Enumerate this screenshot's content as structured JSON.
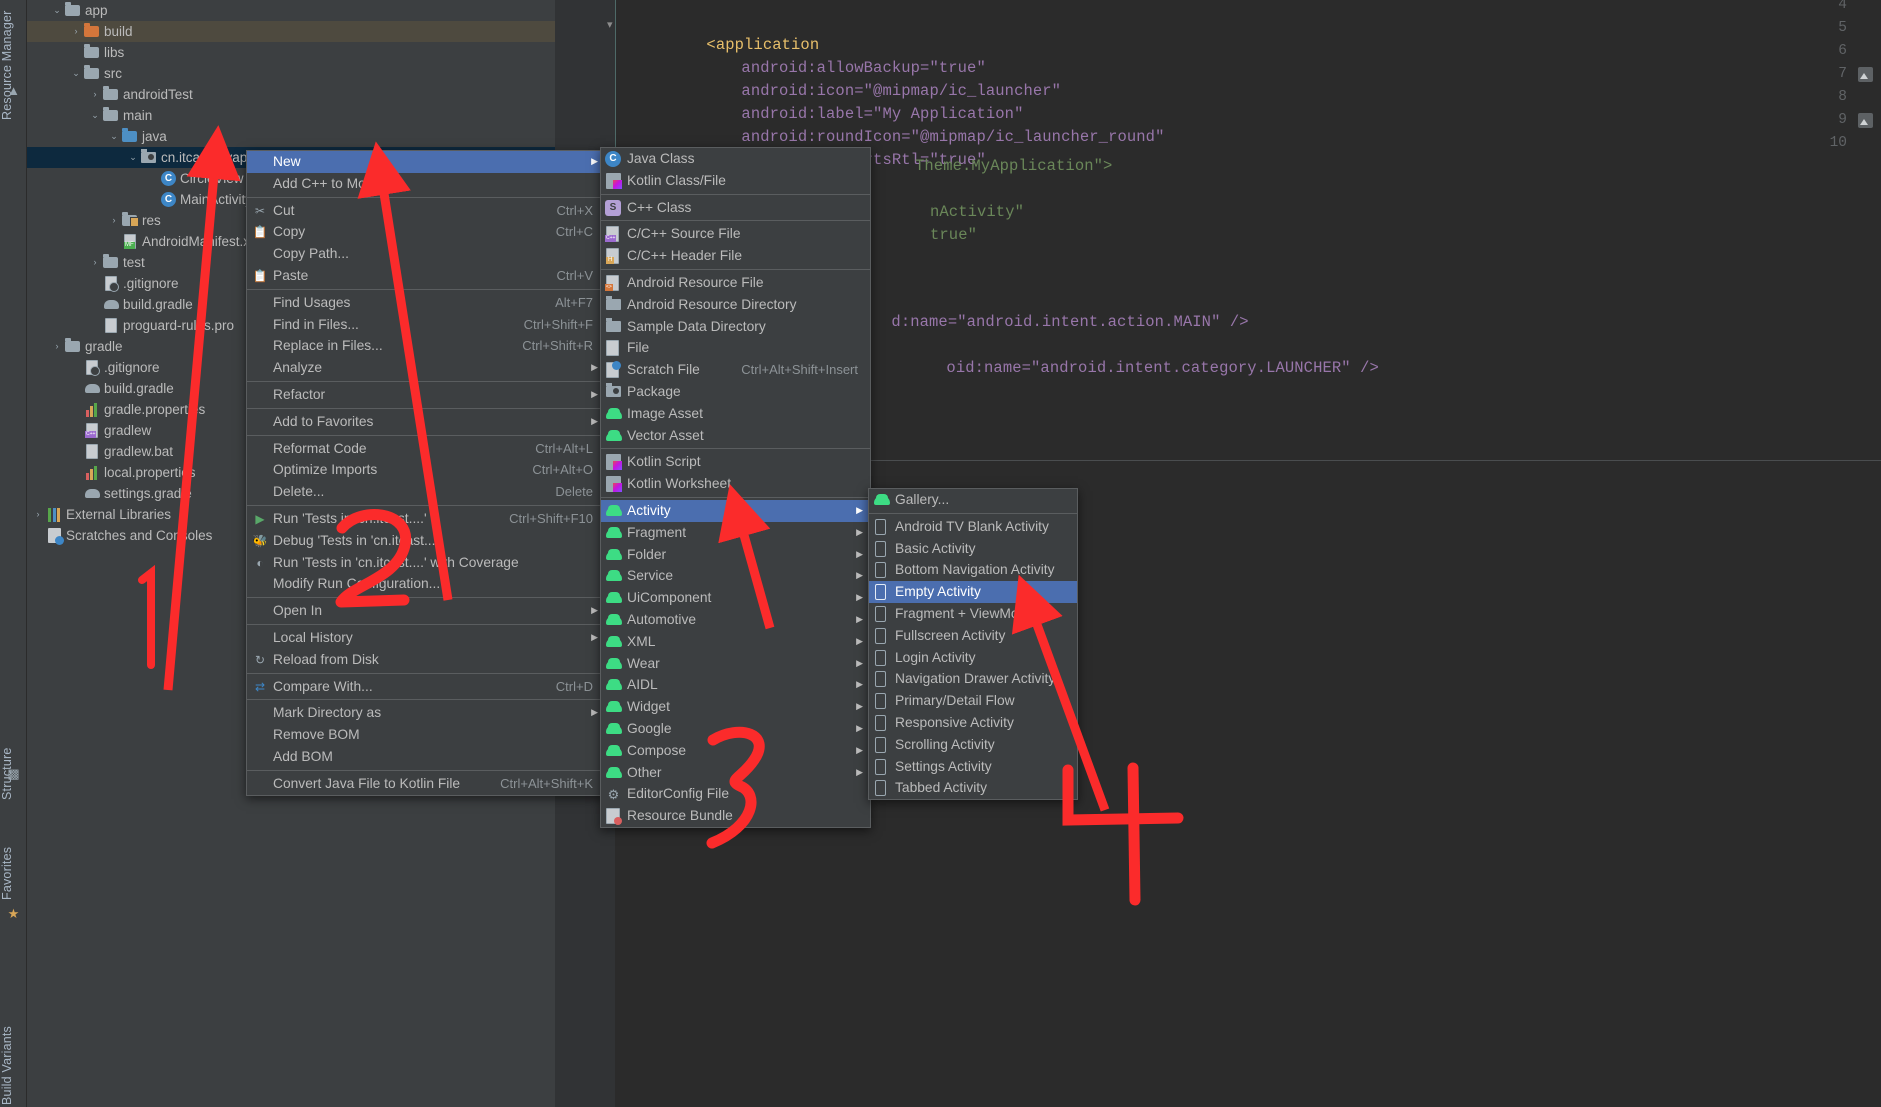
{
  "app": {
    "title": "Android Studio Project Tool Window with New > Activity > Empty Activity context menu"
  },
  "left_strip": {
    "tabs": [
      {
        "label": "Resource Manager",
        "name": "resource-manager-tab"
      },
      {
        "label": "Structure",
        "name": "structure-tab"
      },
      {
        "label": "Favorites",
        "name": "favorites-tab"
      },
      {
        "label": "Build Variants",
        "name": "build-variants-tab"
      }
    ]
  },
  "project_tree": {
    "nodes": [
      {
        "label": "app",
        "indent": 1,
        "chevron": "v",
        "icon": "module-folder",
        "state": ""
      },
      {
        "label": "build",
        "indent": 2,
        "chevron": ">",
        "icon": "folder-orange",
        "state": "highlighted"
      },
      {
        "label": "libs",
        "indent": 2,
        "chevron": "",
        "icon": "folder",
        "state": ""
      },
      {
        "label": "src",
        "indent": 2,
        "chevron": "v",
        "icon": "folder",
        "state": ""
      },
      {
        "label": "androidTest",
        "indent": 3,
        "chevron": ">",
        "icon": "folder",
        "state": ""
      },
      {
        "label": "main",
        "indent": 3,
        "chevron": "v",
        "icon": "folder",
        "state": ""
      },
      {
        "label": "java",
        "indent": 4,
        "chevron": "v",
        "icon": "folder-blue",
        "state": ""
      },
      {
        "label": "cn.itcast.myapplication",
        "indent": 5,
        "chevron": "v",
        "icon": "package",
        "state": "selected"
      },
      {
        "label": "CircleView",
        "indent": 6,
        "chevron": "",
        "icon": "class",
        "state": ""
      },
      {
        "label": "MainActivity",
        "indent": 6,
        "chevron": "",
        "icon": "class",
        "state": ""
      },
      {
        "label": "res",
        "indent": 4,
        "chevron": ">",
        "icon": "folder-res",
        "state": ""
      },
      {
        "label": "AndroidManifest.xml",
        "indent": 4,
        "chevron": "",
        "icon": "manifest",
        "state": ""
      },
      {
        "label": "test",
        "indent": 3,
        "chevron": ">",
        "icon": "folder",
        "state": ""
      },
      {
        "label": ".gitignore",
        "indent": 3,
        "chevron": "",
        "icon": "gitignore",
        "state": ""
      },
      {
        "label": "build.gradle",
        "indent": 3,
        "chevron": "",
        "icon": "gradle",
        "state": ""
      },
      {
        "label": "proguard-rules.pro",
        "indent": 3,
        "chevron": "",
        "icon": "file",
        "state": ""
      },
      {
        "label": "gradle",
        "indent": 1,
        "chevron": ">",
        "icon": "folder",
        "state": ""
      },
      {
        "label": ".gitignore",
        "indent": 2,
        "chevron": "",
        "icon": "gitignore",
        "state": ""
      },
      {
        "label": "build.gradle",
        "indent": 2,
        "chevron": "",
        "icon": "gradle",
        "state": ""
      },
      {
        "label": "gradle.properties",
        "indent": 2,
        "chevron": "",
        "icon": "properties",
        "state": ""
      },
      {
        "label": "gradlew",
        "indent": 2,
        "chevron": "",
        "icon": "cppfile",
        "state": ""
      },
      {
        "label": "gradlew.bat",
        "indent": 2,
        "chevron": "",
        "icon": "file",
        "state": ""
      },
      {
        "label": "local.properties",
        "indent": 2,
        "chevron": "",
        "icon": "properties",
        "state": ""
      },
      {
        "label": "settings.gradle",
        "indent": 2,
        "chevron": "",
        "icon": "gradle",
        "state": ""
      },
      {
        "label": "External Libraries",
        "indent": 0,
        "chevron": ">",
        "icon": "libraries",
        "state": ""
      },
      {
        "label": "Scratches and Consoles",
        "indent": 0,
        "chevron": "",
        "icon": "scratches",
        "state": ""
      }
    ]
  },
  "editor": {
    "line_numbers": [
      "4",
      "5",
      "6",
      "7",
      "8",
      "9",
      "10"
    ],
    "lines": [
      {
        "n": "4",
        "text": ""
      },
      {
        "n": "5",
        "text": "<application"
      },
      {
        "n": "6",
        "text": "android:allowBackup=\"true\""
      },
      {
        "n": "7",
        "text": "android:icon=\"@mipmap/ic_launcher\""
      },
      {
        "n": "8",
        "text": "android:label=\"My Application\""
      },
      {
        "n": "9",
        "text": "android:roundIcon=\"@mipmap/ic_launcher_round\""
      },
      {
        "n": "10",
        "text": "android:supportsRtl=\"true\""
      }
    ],
    "fragments": [
      "Theme.MyApplication\">",
      "nActivity\"",
      "true\"",
      "d:name=\"android.intent.action.MAIN\" />",
      "oid:name=\"android.intent.category.LAUNCHER\" />"
    ],
    "highlighted_value": "\"My Application\""
  },
  "context_menu": {
    "items": [
      {
        "label": "New",
        "shortcut": "",
        "icon": "",
        "submenu": true,
        "highlighted": true,
        "sep_after": false
      },
      {
        "label": "Add C++ to Module",
        "shortcut": "",
        "icon": "",
        "submenu": false,
        "highlighted": false,
        "sep_after": true
      },
      {
        "label": "Cut",
        "shortcut": "Ctrl+X",
        "icon": "scissors",
        "submenu": false,
        "highlighted": false,
        "sep_after": false
      },
      {
        "label": "Copy",
        "shortcut": "Ctrl+C",
        "icon": "copy",
        "submenu": false,
        "highlighted": false,
        "sep_after": false
      },
      {
        "label": "Copy Path...",
        "shortcut": "",
        "icon": "",
        "submenu": false,
        "highlighted": false,
        "sep_after": false
      },
      {
        "label": "Paste",
        "shortcut": "Ctrl+V",
        "icon": "paste",
        "submenu": false,
        "highlighted": false,
        "sep_after": true
      },
      {
        "label": "Find Usages",
        "shortcut": "Alt+F7",
        "icon": "",
        "submenu": false,
        "highlighted": false,
        "sep_after": false
      },
      {
        "label": "Find in Files...",
        "shortcut": "Ctrl+Shift+F",
        "icon": "",
        "submenu": false,
        "highlighted": false,
        "sep_after": false
      },
      {
        "label": "Replace in Files...",
        "shortcut": "Ctrl+Shift+R",
        "icon": "",
        "submenu": false,
        "highlighted": false,
        "sep_after": false
      },
      {
        "label": "Analyze",
        "shortcut": "",
        "icon": "",
        "submenu": true,
        "highlighted": false,
        "sep_after": true
      },
      {
        "label": "Refactor",
        "shortcut": "",
        "icon": "",
        "submenu": true,
        "highlighted": false,
        "sep_after": true
      },
      {
        "label": "Add to Favorites",
        "shortcut": "",
        "icon": "",
        "submenu": true,
        "highlighted": false,
        "sep_after": true
      },
      {
        "label": "Reformat Code",
        "shortcut": "Ctrl+Alt+L",
        "icon": "",
        "submenu": false,
        "highlighted": false,
        "sep_after": false
      },
      {
        "label": "Optimize Imports",
        "shortcut": "Ctrl+Alt+O",
        "icon": "",
        "submenu": false,
        "highlighted": false,
        "sep_after": false
      },
      {
        "label": "Delete...",
        "shortcut": "Delete",
        "icon": "",
        "submenu": false,
        "highlighted": false,
        "sep_after": true
      },
      {
        "label": "Run 'Tests in 'cn.itcast....'",
        "shortcut": "Ctrl+Shift+F10",
        "icon": "run",
        "submenu": false,
        "highlighted": false,
        "sep_after": false
      },
      {
        "label": "Debug 'Tests in 'cn.itcast....'",
        "shortcut": "",
        "icon": "debug",
        "submenu": false,
        "highlighted": false,
        "sep_after": false
      },
      {
        "label": "Run 'Tests in 'cn.itcast....' with Coverage",
        "shortcut": "",
        "icon": "coverage",
        "submenu": false,
        "highlighted": false,
        "sep_after": false
      },
      {
        "label": "Modify Run Configuration...",
        "shortcut": "",
        "icon": "",
        "submenu": false,
        "highlighted": false,
        "sep_after": true
      },
      {
        "label": "Open In",
        "shortcut": "",
        "icon": "",
        "submenu": true,
        "highlighted": false,
        "sep_after": true
      },
      {
        "label": "Local History",
        "shortcut": "",
        "icon": "",
        "submenu": true,
        "highlighted": false,
        "sep_after": false
      },
      {
        "label": "Reload from Disk",
        "shortcut": "",
        "icon": "reload",
        "submenu": false,
        "highlighted": false,
        "sep_after": true
      },
      {
        "label": "Compare With...",
        "shortcut": "Ctrl+D",
        "icon": "compare",
        "submenu": false,
        "highlighted": false,
        "sep_after": true
      },
      {
        "label": "Mark Directory as",
        "shortcut": "",
        "icon": "",
        "submenu": true,
        "highlighted": false,
        "sep_after": false
      },
      {
        "label": "Remove BOM",
        "shortcut": "",
        "icon": "",
        "submenu": false,
        "highlighted": false,
        "sep_after": false
      },
      {
        "label": "Add BOM",
        "shortcut": "",
        "icon": "",
        "submenu": false,
        "highlighted": false,
        "sep_after": true
      },
      {
        "label": "Convert Java File to Kotlin File",
        "shortcut": "Ctrl+Alt+Shift+K",
        "icon": "",
        "submenu": false,
        "highlighted": false,
        "sep_after": false
      }
    ]
  },
  "new_submenu": {
    "items": [
      {
        "label": "Java Class",
        "shortcut": "",
        "icon": "java-class",
        "submenu": false,
        "highlighted": false,
        "sep_after": false
      },
      {
        "label": "Kotlin Class/File",
        "shortcut": "",
        "icon": "kotlin",
        "submenu": false,
        "highlighted": false,
        "sep_after": true
      },
      {
        "label": "C++ Class",
        "shortcut": "",
        "icon": "cpp-class",
        "submenu": false,
        "highlighted": false,
        "sep_after": true
      },
      {
        "label": "C/C++ Source File",
        "shortcut": "",
        "icon": "cpp-source",
        "submenu": false,
        "highlighted": false,
        "sep_after": false
      },
      {
        "label": "C/C++ Header File",
        "shortcut": "",
        "icon": "cpp-header",
        "submenu": false,
        "highlighted": false,
        "sep_after": true
      },
      {
        "label": "Android Resource File",
        "shortcut": "",
        "icon": "android-res-file",
        "submenu": false,
        "highlighted": false,
        "sep_after": false
      },
      {
        "label": "Android Resource Directory",
        "shortcut": "",
        "icon": "folder",
        "submenu": false,
        "highlighted": false,
        "sep_after": false
      },
      {
        "label": "Sample Data Directory",
        "shortcut": "",
        "icon": "folder",
        "submenu": false,
        "highlighted": false,
        "sep_after": false
      },
      {
        "label": "File",
        "shortcut": "",
        "icon": "file",
        "submenu": false,
        "highlighted": false,
        "sep_after": false
      },
      {
        "label": "Scratch File",
        "shortcut": "Ctrl+Alt+Shift+Insert",
        "icon": "scratch-file",
        "submenu": false,
        "highlighted": false,
        "sep_after": false
      },
      {
        "label": "Package",
        "shortcut": "",
        "icon": "package",
        "submenu": false,
        "highlighted": false,
        "sep_after": false
      },
      {
        "label": "Image Asset",
        "shortcut": "",
        "icon": "android",
        "submenu": false,
        "highlighted": false,
        "sep_after": false
      },
      {
        "label": "Vector Asset",
        "shortcut": "",
        "icon": "android",
        "submenu": false,
        "highlighted": false,
        "sep_after": true
      },
      {
        "label": "Kotlin Script",
        "shortcut": "",
        "icon": "kotlin",
        "submenu": false,
        "highlighted": false,
        "sep_after": false
      },
      {
        "label": "Kotlin Worksheet",
        "shortcut": "",
        "icon": "kotlin",
        "submenu": false,
        "highlighted": false,
        "sep_after": true
      },
      {
        "label": "Activity",
        "shortcut": "",
        "icon": "android",
        "submenu": true,
        "highlighted": true,
        "sep_after": false
      },
      {
        "label": "Fragment",
        "shortcut": "",
        "icon": "android",
        "submenu": true,
        "highlighted": false,
        "sep_after": false
      },
      {
        "label": "Folder",
        "shortcut": "",
        "icon": "android",
        "submenu": true,
        "highlighted": false,
        "sep_after": false
      },
      {
        "label": "Service",
        "shortcut": "",
        "icon": "android",
        "submenu": true,
        "highlighted": false,
        "sep_after": false
      },
      {
        "label": "UiComponent",
        "shortcut": "",
        "icon": "android",
        "submenu": true,
        "highlighted": false,
        "sep_after": false
      },
      {
        "label": "Automotive",
        "shortcut": "",
        "icon": "android",
        "submenu": true,
        "highlighted": false,
        "sep_after": false
      },
      {
        "label": "XML",
        "shortcut": "",
        "icon": "android",
        "submenu": true,
        "highlighted": false,
        "sep_after": false
      },
      {
        "label": "Wear",
        "shortcut": "",
        "icon": "android",
        "submenu": true,
        "highlighted": false,
        "sep_after": false
      },
      {
        "label": "AIDL",
        "shortcut": "",
        "icon": "android",
        "submenu": true,
        "highlighted": false,
        "sep_after": false
      },
      {
        "label": "Widget",
        "shortcut": "",
        "icon": "android",
        "submenu": true,
        "highlighted": false,
        "sep_after": false
      },
      {
        "label": "Google",
        "shortcut": "",
        "icon": "android",
        "submenu": true,
        "highlighted": false,
        "sep_after": false
      },
      {
        "label": "Compose",
        "shortcut": "",
        "icon": "android",
        "submenu": true,
        "highlighted": false,
        "sep_after": false
      },
      {
        "label": "Other",
        "shortcut": "",
        "icon": "android",
        "submenu": true,
        "highlighted": false,
        "sep_after": false
      },
      {
        "label": "EditorConfig File",
        "shortcut": "",
        "icon": "gear",
        "submenu": false,
        "highlighted": false,
        "sep_after": false
      },
      {
        "label": "Resource Bundle",
        "shortcut": "",
        "icon": "resource-bundle",
        "submenu": false,
        "highlighted": false,
        "sep_after": false
      }
    ]
  },
  "activity_submenu": {
    "items": [
      {
        "label": "Gallery...",
        "icon": "android",
        "highlighted": false,
        "sep_after": true
      },
      {
        "label": "Android TV Blank Activity",
        "icon": "phone",
        "highlighted": false,
        "sep_after": false
      },
      {
        "label": "Basic Activity",
        "icon": "phone",
        "highlighted": false,
        "sep_after": false
      },
      {
        "label": "Bottom Navigation Activity",
        "icon": "phone",
        "highlighted": false,
        "sep_after": false
      },
      {
        "label": "Empty Activity",
        "icon": "phone",
        "highlighted": true,
        "sep_after": false
      },
      {
        "label": "Fragment + ViewModel",
        "icon": "phone",
        "highlighted": false,
        "sep_after": false
      },
      {
        "label": "Fullscreen Activity",
        "icon": "phone",
        "highlighted": false,
        "sep_after": false
      },
      {
        "label": "Login Activity",
        "icon": "phone",
        "highlighted": false,
        "sep_after": false
      },
      {
        "label": "Navigation Drawer Activity",
        "icon": "phone",
        "highlighted": false,
        "sep_after": false
      },
      {
        "label": "Primary/Detail Flow",
        "icon": "phone",
        "highlighted": false,
        "sep_after": false
      },
      {
        "label": "Responsive Activity",
        "icon": "phone",
        "highlighted": false,
        "sep_after": false
      },
      {
        "label": "Scrolling Activity",
        "icon": "phone",
        "highlighted": false,
        "sep_after": false
      },
      {
        "label": "Settings Activity",
        "icon": "phone",
        "highlighted": false,
        "sep_after": false
      },
      {
        "label": "Tabbed Activity",
        "icon": "phone",
        "highlighted": false,
        "sep_after": false
      }
    ]
  },
  "annotations": {
    "color": "#fb2b2b",
    "steps": [
      {
        "label": "1",
        "target": "cn.itcast.myapplication package node"
      },
      {
        "label": "2",
        "target": "New menu item"
      },
      {
        "label": "3",
        "target": "Activity submenu item"
      },
      {
        "label": "4",
        "target": "Empty Activity template"
      }
    ]
  }
}
